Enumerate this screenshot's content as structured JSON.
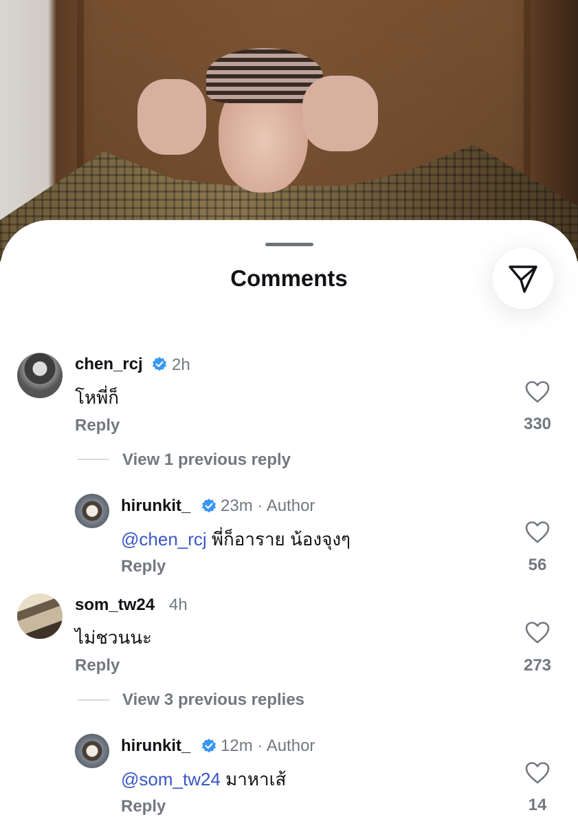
{
  "sheet": {
    "title": "Comments"
  },
  "colors": {
    "mention": "#3856c8",
    "muted": "#737880",
    "verified": "#3897f0"
  },
  "icons": {
    "share": "send-icon",
    "like": "heart-outline-icon",
    "verified": "verified-badge-icon"
  },
  "comments": [
    {
      "username": "chen_rcj",
      "verified": true,
      "time": "2h",
      "text": "โหพี่ก็",
      "reply_label": "Reply",
      "likes": "330",
      "view_replies": "View 1 previous reply",
      "replies": [
        {
          "username": "hirunkit_",
          "verified": true,
          "time": "23m · Author",
          "mention": "@chen_rcj",
          "text": " พี่ก็อาราย น้องจุงๆ",
          "reply_label": "Reply",
          "likes": "56"
        }
      ]
    },
    {
      "username": "som_tw24",
      "verified": false,
      "time": "4h",
      "text": "ไม่ชวนนะ",
      "reply_label": "Reply",
      "likes": "273",
      "view_replies": "View 3 previous replies",
      "replies": [
        {
          "username": "hirunkit_",
          "verified": true,
          "time": "12m · Author",
          "mention": "@som_tw24",
          "text": " มาหาเส้",
          "reply_label": "Reply",
          "likes": "14"
        }
      ]
    }
  ]
}
